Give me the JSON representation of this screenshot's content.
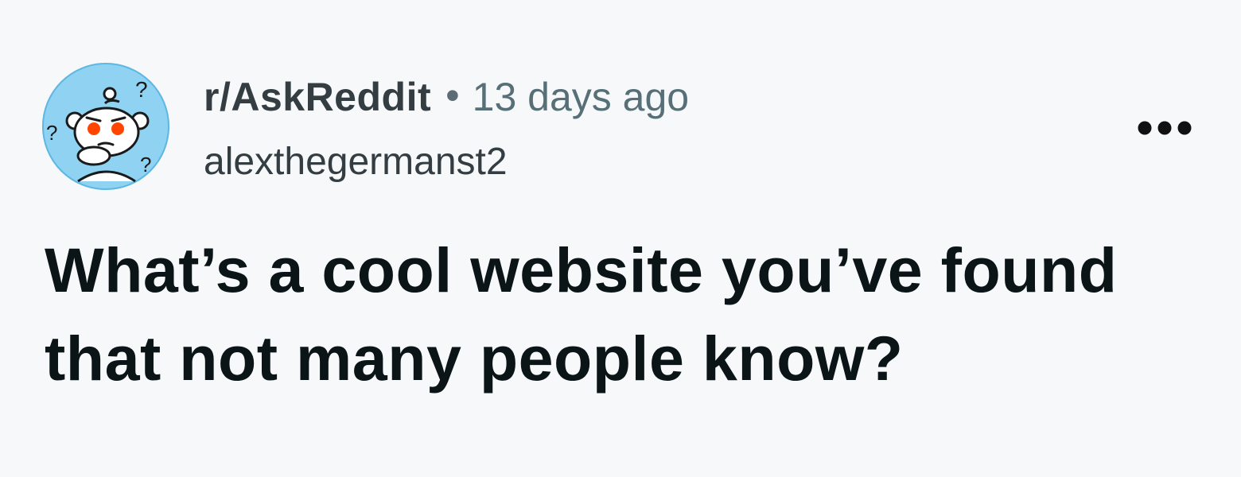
{
  "post": {
    "avatar_icon": "confused-snoo-icon",
    "subreddit": "r/AskReddit",
    "separator": "•",
    "time_ago": "13 days ago",
    "username": "alexthegermanst2",
    "more_icon": "more-options-icon",
    "title": "What’s a cool website you’ve found that not many people know?"
  },
  "colors": {
    "background": "#f7f8fa",
    "avatar_bg": "#8fd2f2",
    "snoo_eye": "#ff4500",
    "title_text": "#0b1416",
    "meta_text": "#333d42",
    "time_text": "#576f76"
  }
}
